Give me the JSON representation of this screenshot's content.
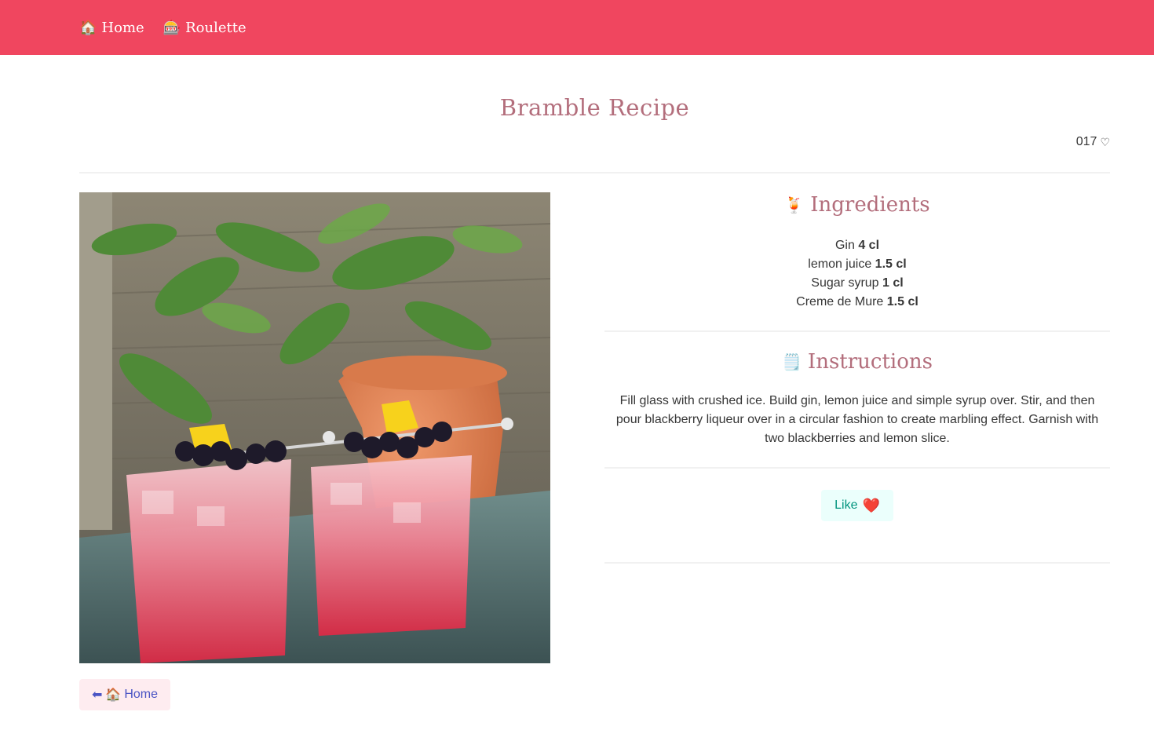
{
  "nav": {
    "home": {
      "icon": "🏠",
      "label": "Home"
    },
    "roulette": {
      "icon": "🎰",
      "label": "Roulette"
    }
  },
  "page": {
    "title": "Bramble Recipe",
    "likes_count": "017",
    "likes_icon": "♡"
  },
  "ingredients": {
    "icon": "🍹",
    "title": "Ingredients",
    "items": [
      {
        "name": "Gin",
        "amount": "4 cl"
      },
      {
        "name": "lemon juice",
        "amount": "1.5 cl"
      },
      {
        "name": "Sugar syrup",
        "amount": "1 cl"
      },
      {
        "name": "Creme de Mure",
        "amount": "1.5 cl"
      }
    ]
  },
  "instructions": {
    "icon": "🗒️",
    "title": "Instructions",
    "text": "Fill glass with crushed ice. Build gin, lemon juice and simple syrup over. Stir, and then pour blackberry liqueur over in a circular fashion to create marbling effect. Garnish with two blackberries and lemon slice."
  },
  "actions": {
    "like_label": "Like",
    "like_icon": "❤️",
    "back_arrow": "⬅",
    "back_icon": "🏠",
    "back_label": "Home"
  },
  "colors": {
    "navbar": "#f0465f",
    "title": "#b36e7c",
    "like_bg": "#ebfffc",
    "like_text": "#00947e",
    "back_bg": "#feecf0",
    "back_text": "#4a54c4"
  },
  "photo": {
    "subject": "cocktail-photo"
  }
}
